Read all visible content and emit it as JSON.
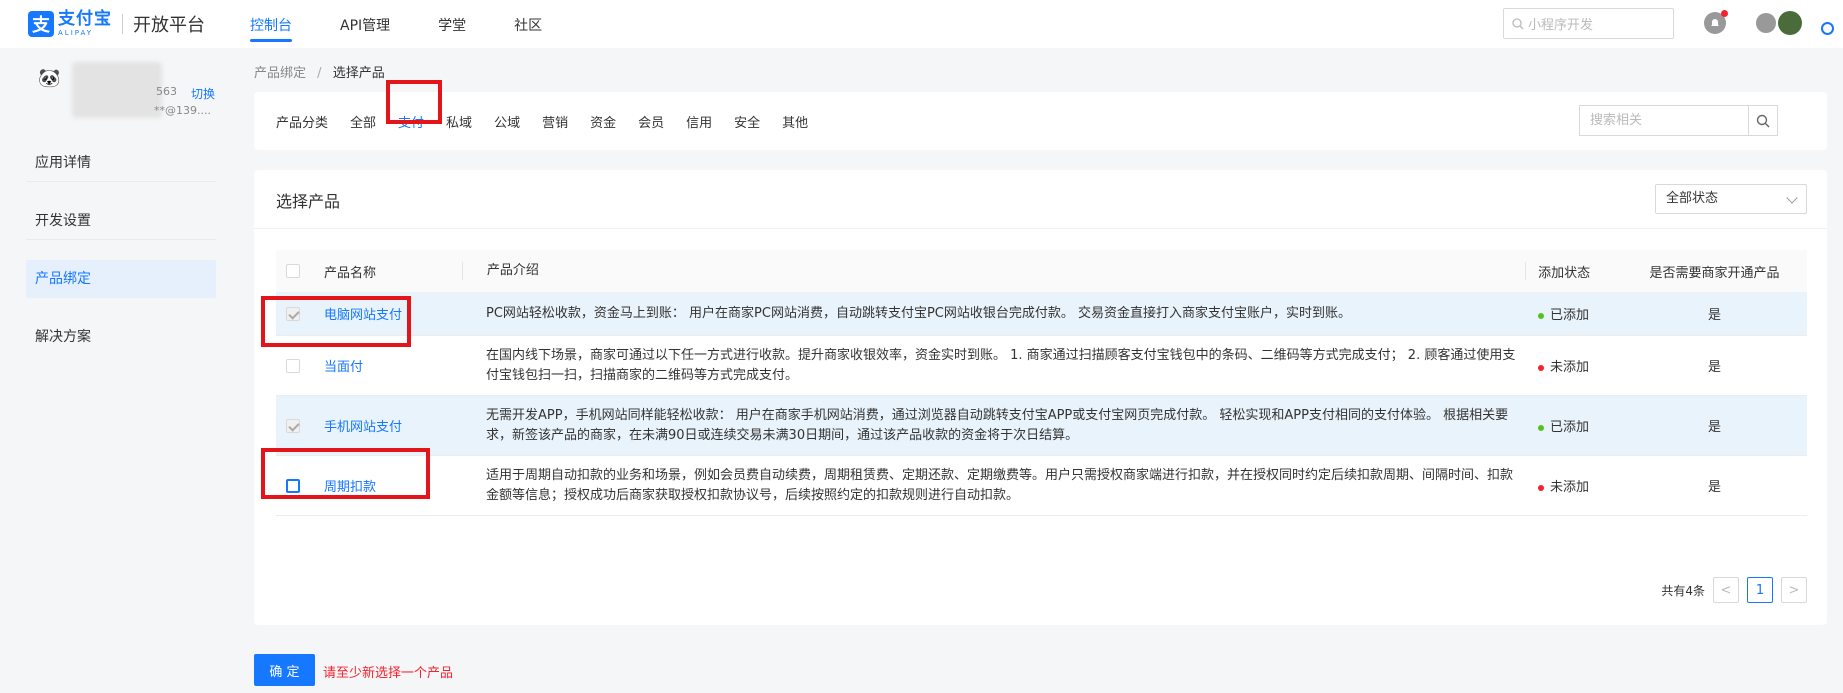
{
  "header": {
    "logo_cn": "支付宝",
    "logo_en": "ALIPAY",
    "platform": "开放平台",
    "nav": [
      "控制台",
      "API管理",
      "学堂",
      "社区"
    ],
    "search_placeholder": "小程序开发"
  },
  "account": {
    "id_suffix": "563",
    "switch_label": "切换",
    "email_suffix": "**@139...."
  },
  "sidebar": {
    "items": [
      {
        "label": "应用详情"
      },
      {
        "label": "开发设置"
      },
      {
        "label": "产品绑定"
      },
      {
        "label": "解决方案"
      }
    ]
  },
  "breadcrumb": {
    "parent": "产品绑定",
    "separator": "/",
    "current": "选择产品"
  },
  "categories": {
    "label": "产品分类",
    "items": [
      "全部",
      "支付",
      "私域",
      "公域",
      "营销",
      "资金",
      "会员",
      "信用",
      "安全",
      "其他"
    ],
    "active": "支付",
    "search_placeholder": "搜索相关"
  },
  "products": {
    "title": "选择产品",
    "status_filter": "全部状态",
    "columns": {
      "name": "产品名称",
      "desc": "产品介绍",
      "status": "添加状态",
      "need": "是否需要商家开通产品"
    },
    "rows": [
      {
        "name": "电脑网站支付",
        "desc": "PC网站轻松收款，资金马上到账： 用户在商家PC网站消费，自动跳转支付宝PC网站收银台完成付款。 交易资金直接打入商家支付宝账户，实时到账。",
        "status": "已添加",
        "need": "是"
      },
      {
        "name": "当面付",
        "desc": "在国内线下场景，商家可通过以下任一方式进行收款。提升商家收银效率，资金实时到账。 1. 商家通过扫描顾客支付宝钱包中的条码、二维码等方式完成支付； 2. 顾客通过使用支付宝钱包扫一扫，扫描商家的二维码等方式完成支付。",
        "status": "未添加",
        "need": "是"
      },
      {
        "name": "手机网站支付",
        "desc": "无需开发APP，手机网站同样能轻松收款： 用户在商家手机网站消费，通过浏览器自动跳转支付宝APP或支付宝网页完成付款。 轻松实现和APP支付相同的支付体验。 根据相关要求，新签该产品的商家，在未满90日或连续交易未满30日期间，通过该产品收款的资金将于次日结算。",
        "status": "已添加",
        "need": "是"
      },
      {
        "name": "周期扣款",
        "desc": "适用于周期自动扣款的业务和场景，例如会员费自动续费，周期租赁费、定期还款、定期缴费等。用户只需授权商家端进行扣款，并在授权同时约定后续扣款周期、间隔时间、扣款金额等信息；授权成功后商家获取授权扣款协议号，后续按照约定的扣款规则进行自动扣款。",
        "status": "未添加",
        "need": "是"
      }
    ],
    "total": "共有4条",
    "page": "1"
  },
  "footer": {
    "confirm": "确 定",
    "hint": "请至少新选择一个产品"
  },
  "colors": {
    "primary": "#1677ff",
    "highlight": "#e4141b",
    "added": "#52c41a",
    "not_added": "#f5222d"
  }
}
